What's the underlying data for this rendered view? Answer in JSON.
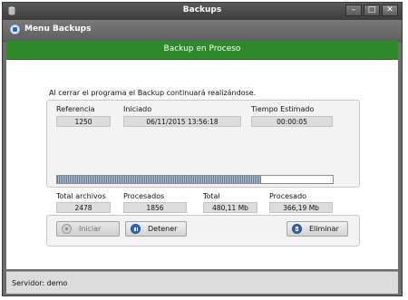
{
  "window": {
    "title": "Backups",
    "controls": [
      "minimize",
      "maximize",
      "close"
    ]
  },
  "menu": {
    "label": "Menu Backups",
    "icon": "database-icon"
  },
  "banner": {
    "text": "Backup en Proceso",
    "color": "#2c8a2a"
  },
  "notice": "Al cerrar el programa el Backup continuará realizándose.",
  "info": {
    "referencia_label": "Referencia",
    "referencia_value": "1250",
    "iniciado_label": "Iniciado",
    "iniciado_value": "06/11/2015 13:56:18",
    "tiempo_label": "Tiempo Estimado",
    "tiempo_value": "00:00:05",
    "progress_percent": 74,
    "total_archivos_label": "Total archivos",
    "total_archivos_value": "2478",
    "procesados_label": "Procesados",
    "procesados_value": "1856",
    "total_label": "Total",
    "total_value": "480,11 Mb",
    "procesado_label": "Procesado",
    "procesado_value": "366,19 Mb"
  },
  "buttons": {
    "iniciar_label": "Iniciar",
    "detener_label": "Detener",
    "eliminar_label": "Eliminar"
  },
  "status": {
    "text": "Servidor: demo"
  }
}
